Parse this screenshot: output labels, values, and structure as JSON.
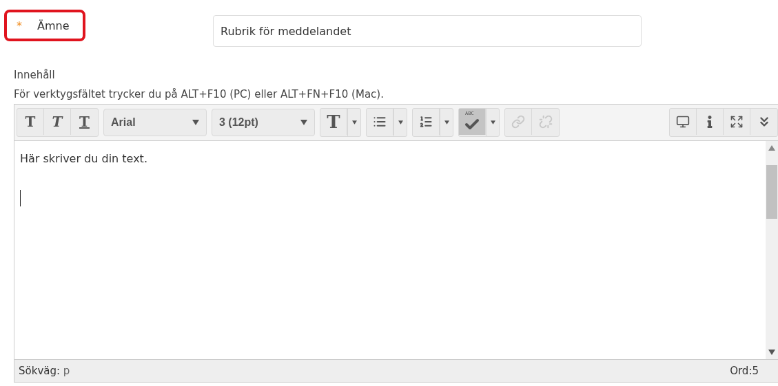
{
  "subject": {
    "required_mark": "*",
    "label": "Ämne",
    "highlighted": true,
    "value": "Rubrik för meddelandet"
  },
  "content": {
    "label": "Innehåll",
    "hint": "För verktygsfältet trycker du på ALT+F10 (PC) eller ALT+FN+F10 (Mac)."
  },
  "toolbar": {
    "left": [
      {
        "kind": "buttons",
        "items": [
          {
            "kind": "bold",
            "glyph": "T"
          },
          {
            "kind": "italic",
            "glyph": "T"
          },
          {
            "kind": "underline",
            "glyph": "T"
          }
        ]
      },
      {
        "kind": "select",
        "value": "Arial"
      },
      {
        "kind": "select",
        "value": "3 (12pt)"
      },
      {
        "kind": "buttons",
        "items": [
          {
            "kind": "color",
            "glyph": "T"
          }
        ]
      },
      {
        "kind": "buttons",
        "items": [
          {
            "kind": "bullets"
          }
        ]
      },
      {
        "kind": "buttons",
        "items": [
          {
            "kind": "numbers"
          }
        ]
      },
      {
        "kind": "buttons",
        "items": [
          {
            "kind": "spellcheck",
            "badge": "ABC",
            "pressed": true
          }
        ]
      },
      {
        "kind": "buttons",
        "items": [
          {
            "kind": "link",
            "disabled": true
          },
          {
            "kind": "unlink",
            "disabled": true
          }
        ]
      }
    ],
    "right": [
      {
        "kind": "preview"
      },
      {
        "kind": "info"
      },
      {
        "kind": "fullscreen"
      },
      {
        "kind": "more"
      }
    ]
  },
  "editor": {
    "text": "Här skriver du din text."
  },
  "status_bar": {
    "path_label": "Sökväg:",
    "path": "p",
    "word_count": "Ord:5"
  }
}
